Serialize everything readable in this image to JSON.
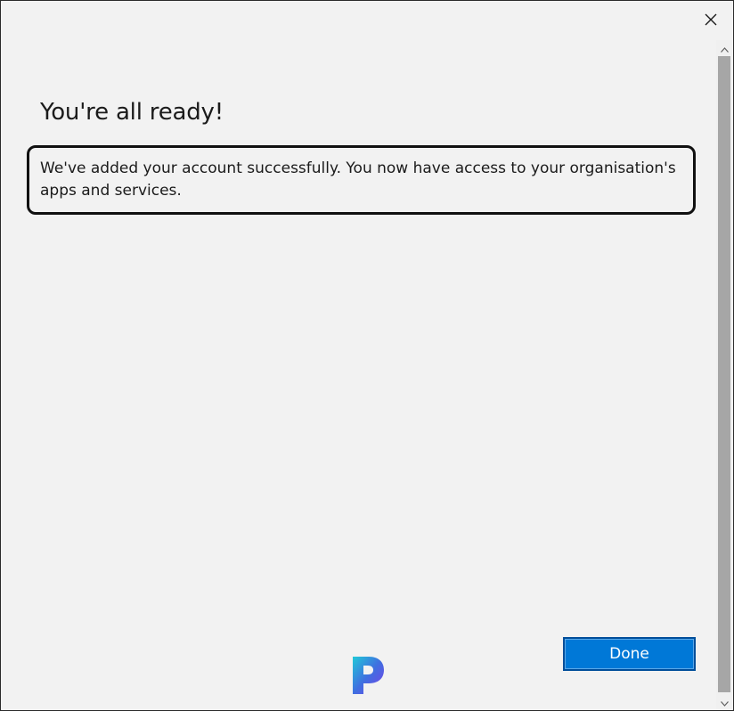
{
  "dialog": {
    "title": "You're all ready!",
    "message": "We've added your account successfully. You now have access to your organisation's apps and services.",
    "done_label": "Done"
  },
  "icons": {
    "close": "close-icon",
    "scroll_up": "chevron-up-icon",
    "scroll_down": "chevron-down-icon",
    "watermark": "p-logo-icon"
  },
  "colors": {
    "accent": "#0078d7",
    "background": "#f2f2f2",
    "text": "#1b1b1b"
  }
}
